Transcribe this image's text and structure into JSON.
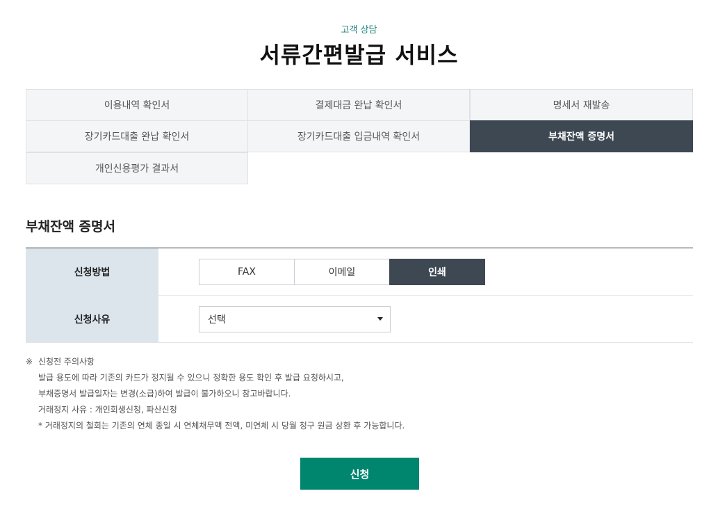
{
  "header": {
    "eyebrow": "고객 상담",
    "title": "서류간편발급 서비스"
  },
  "tabs": [
    {
      "label": "이용내역 확인서",
      "active": false
    },
    {
      "label": "결제대금 완납 확인서",
      "active": false
    },
    {
      "label": "명세서 재발송",
      "active": false
    },
    {
      "label": "장기카드대출 완납 확인서",
      "active": false
    },
    {
      "label": "장기카드대출 입금내역 확인서",
      "active": false
    },
    {
      "label": "부채잔액 증명서",
      "active": true
    },
    {
      "label": "개인신용평가 결과서",
      "active": false
    }
  ],
  "section": {
    "title": "부채잔액 증명서"
  },
  "form": {
    "method_label": "신청방법",
    "methods": [
      {
        "label": "FAX",
        "active": false
      },
      {
        "label": "이메일",
        "active": false
      },
      {
        "label": "인쇄",
        "active": true
      }
    ],
    "reason_label": "신청사유",
    "reason_selected": "선택"
  },
  "notice": {
    "mark": "※",
    "title": "신청전 주의사항",
    "lines": [
      "발급 용도에 따라 기존의 카드가 정지될 수 있으니 정확한 용도 확인 후 발급 요청하시고,",
      "부채증명서 발급일자는 변경(소급)하여 발급이 불가하오니 참고바랍니다.",
      "거래정지 사유 : 개인회생신청, 파산신청",
      "* 거래정지의 철회는 기존의 연체 종일 시 연체채무액 전액, 미연체 시 당월 청구 원금 상환 후 가능합니다."
    ]
  },
  "submit_label": "신청",
  "colors": {
    "accent": "#00856f",
    "active_tab": "#3e4853",
    "label_bg": "#dce5eb",
    "eyebrow": "#1a7f7a"
  }
}
